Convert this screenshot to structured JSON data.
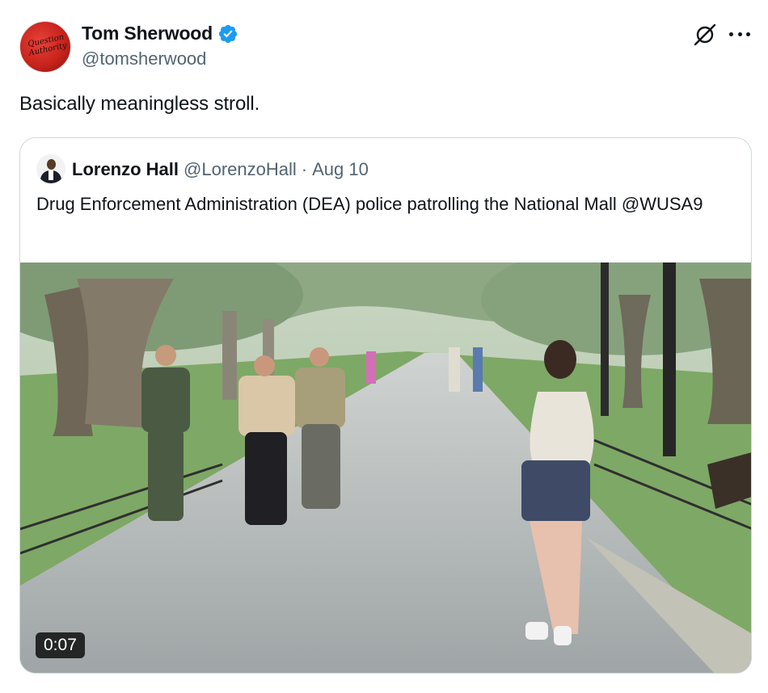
{
  "author": {
    "display_name": "Tom Sherwood",
    "handle": "@tomsherwood",
    "avatar_text": "Question Authority"
  },
  "tweet": {
    "text": "Basically meaningless stroll."
  },
  "quoted": {
    "display_name": "Lorenzo Hall",
    "handle": "@LorenzoHall",
    "separator": "·",
    "date": "Aug 10",
    "text": "Drug Enforcement Administration (DEA) police patrolling the National Mall @WUSA9"
  },
  "media": {
    "duration": "0:07"
  },
  "icons": {
    "verified": "verified-badge-icon",
    "grok": "grok-icon",
    "more": "more-options-icon"
  },
  "colors": {
    "verified_blue": "#1d9bf0",
    "secondary_text": "#536471",
    "border": "#cfd9de"
  }
}
